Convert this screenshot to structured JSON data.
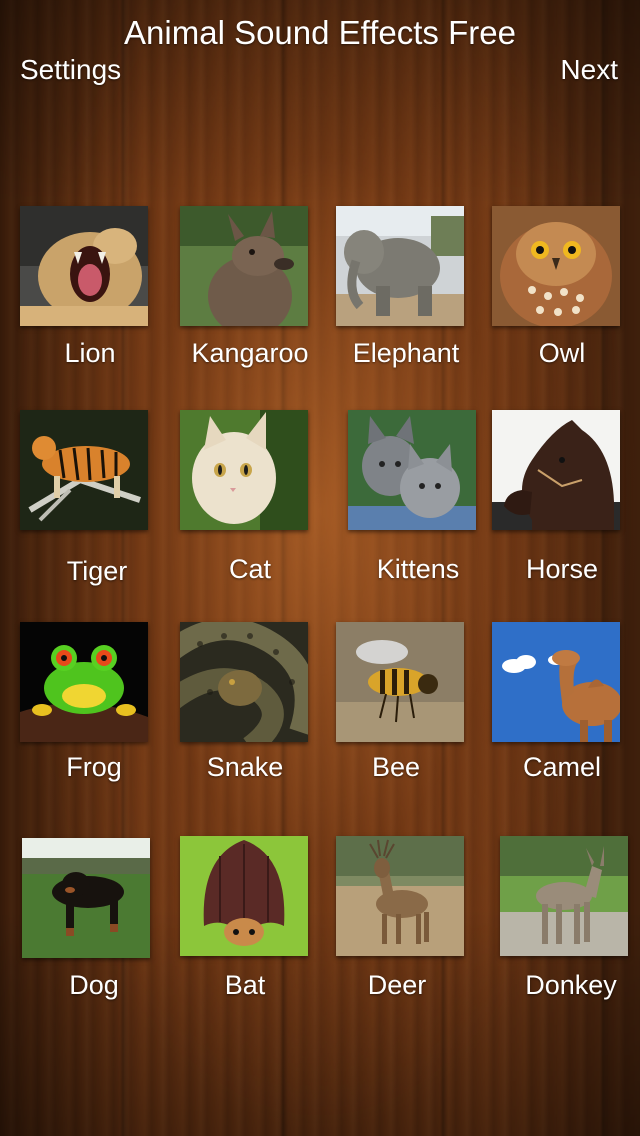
{
  "header": {
    "title": "Animal Sound Effects Free",
    "settings_label": "Settings",
    "next_label": "Next"
  },
  "animals": [
    {
      "label": "Lion"
    },
    {
      "label": "Kangaroo"
    },
    {
      "label": "Elephant"
    },
    {
      "label": "Owl"
    },
    {
      "label": "Tiger"
    },
    {
      "label": "Cat"
    },
    {
      "label": "Kittens"
    },
    {
      "label": "Horse"
    },
    {
      "label": "Frog"
    },
    {
      "label": "Snake"
    },
    {
      "label": "Bee"
    },
    {
      "label": "Camel"
    },
    {
      "label": "Dog"
    },
    {
      "label": "Bat"
    },
    {
      "label": "Deer"
    },
    {
      "label": "Donkey"
    }
  ]
}
